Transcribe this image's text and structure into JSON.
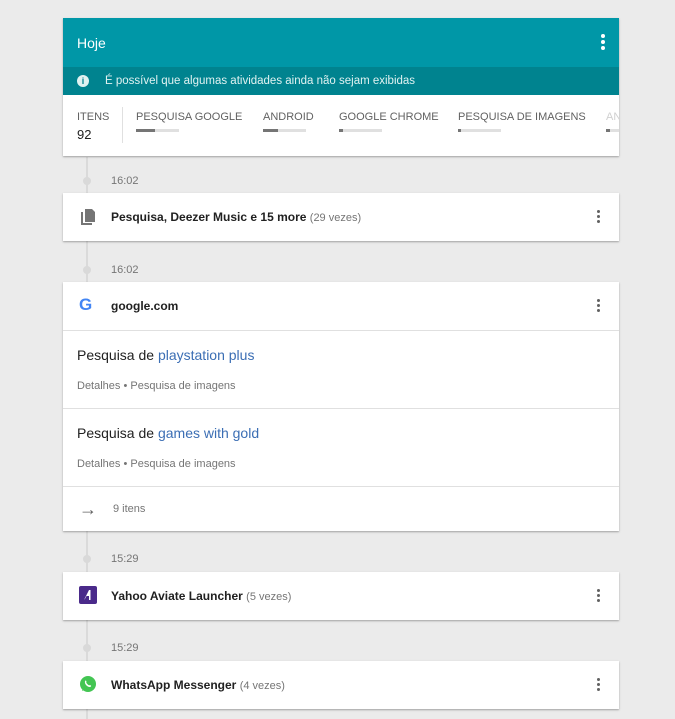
{
  "header": {
    "title": "Hoje",
    "notice": "É possível que algumas atividades ainda não sejam exibidas",
    "stats": [
      {
        "label": "ITENS",
        "count": "92"
      },
      {
        "label": "PESQUISA GOOGLE",
        "fill": 0.45
      },
      {
        "label": "ANDROID",
        "fill": 0.35
      },
      {
        "label": "GOOGLE CHROME",
        "fill": 0.1
      },
      {
        "label": "PESQUISA DE IMAGENS",
        "fill": 0.08
      },
      {
        "label": "AN",
        "fill": 0.1
      }
    ]
  },
  "entries": [
    {
      "time": "16:02",
      "title": "Pesquisa, Deezer Music e 15 more",
      "count": "(29 vezes)",
      "icon": "document-icon"
    },
    {
      "time": "16:02",
      "title": "google.com",
      "icon": "google-icon",
      "searches": [
        {
          "prefix": "Pesquisa de",
          "query": "playstation plus",
          "meta": "Detalhes • Pesquisa de imagens"
        },
        {
          "prefix": "Pesquisa de",
          "query": "games with gold",
          "meta": "Detalhes • Pesquisa de imagens"
        }
      ],
      "more": "9 itens"
    },
    {
      "time": "15:29",
      "title": "Yahoo Aviate Launcher",
      "count": "(5 vezes)",
      "icon": "aviate-icon"
    },
    {
      "time": "15:29",
      "title": "WhatsApp Messenger",
      "count": "(4 vezes)",
      "icon": "whatsapp-icon"
    }
  ],
  "colors": {
    "header": "#0097a7",
    "notice": "#00838f",
    "link": "#3b6eb4"
  }
}
